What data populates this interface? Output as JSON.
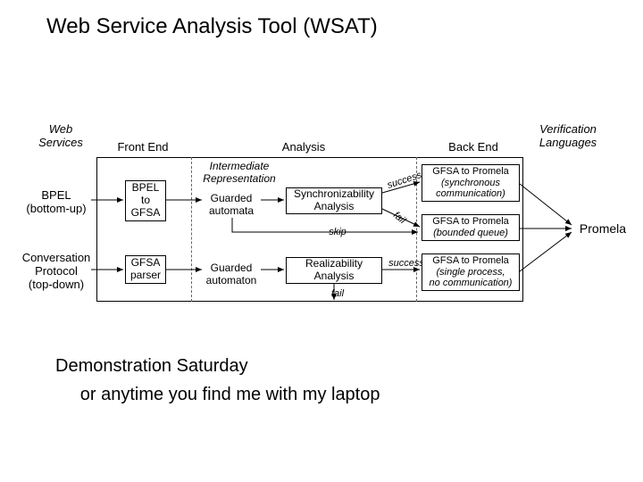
{
  "title": "Web Service Analysis Tool (WSAT)",
  "headers": {
    "web_services": "Web\nServices",
    "front_end": "Front End",
    "analysis": "Analysis",
    "back_end": "Back End",
    "verification_languages": "Verification\nLanguages"
  },
  "left_labels": {
    "bpel": "BPEL\n(bottom-up)",
    "conv": "Conversation\nProtocol\n(top-down)"
  },
  "front_end_boxes": {
    "bpel_to_gfsa": "BPEL\nto\nGFSA",
    "gfsa_parser": "GFSA\nparser"
  },
  "intermediate": {
    "heading": "Intermediate\nRepresentation",
    "guarded_automata": "Guarded\nautomata",
    "guarded_automaton": "Guarded\nautomaton"
  },
  "analysis_boxes": {
    "sync": "Synchronizability\nAnalysis",
    "real": "Realizability\nAnalysis"
  },
  "arrow_labels": {
    "success1": "success",
    "fail1": "fail",
    "skip": "skip",
    "success2": "success",
    "fail2": "fail"
  },
  "back_end_boxes": {
    "sync_promela": "GFSA to Promela\n(synchronous\ncommunication)",
    "bounded_promela": "GFSA to Promela\n(bounded queue)",
    "single_promela": "GFSA to Promela\n(single process,\nno communication)"
  },
  "right_label": "Promela",
  "footer": "Demonstration Saturday\n     or anytime you find me with my laptop"
}
